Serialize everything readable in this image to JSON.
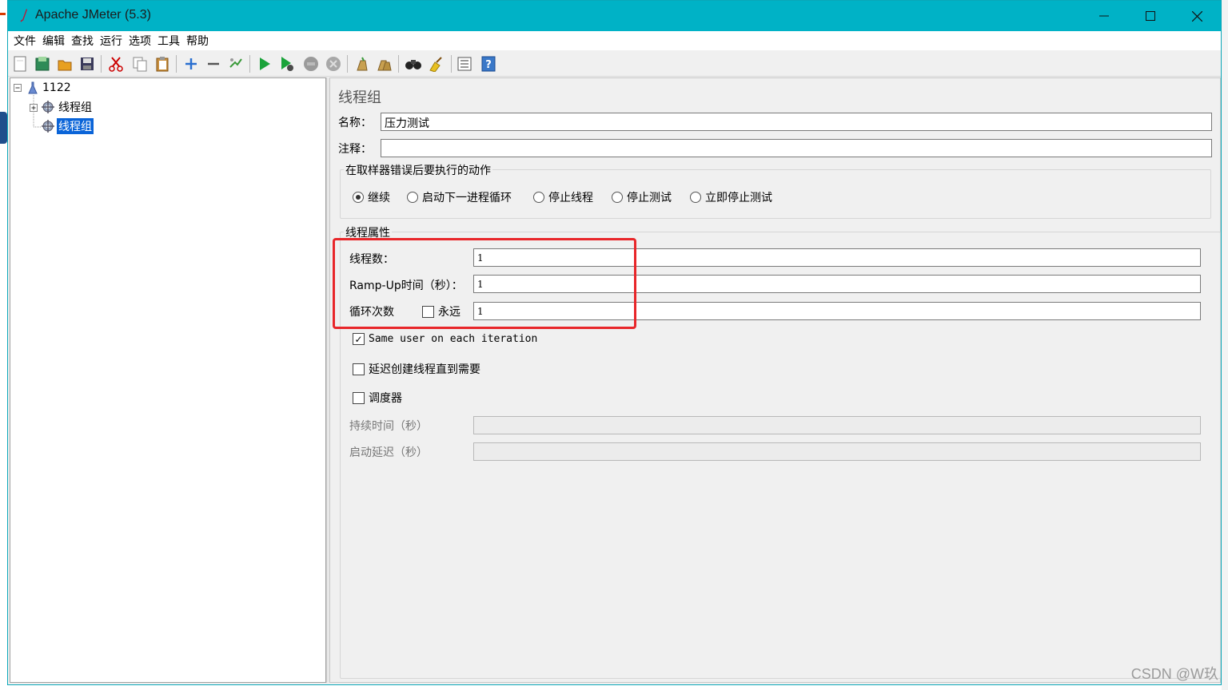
{
  "window": {
    "title": "Apache JMeter (5.3)",
    "controls": {
      "minimize": "—",
      "maximize": "☐",
      "close": "✕"
    }
  },
  "menu": [
    "文件",
    "编辑",
    "查找",
    "运行",
    "选项",
    "工具",
    "帮助"
  ],
  "toolbar": {
    "buttons": [
      "new-icon",
      "templates-icon",
      "open-icon",
      "save-icon",
      "cut-icon",
      "copy-icon",
      "paste-icon",
      "expand-icon",
      "collapse-icon",
      "toggle-icon",
      "start-icon",
      "start-no-timers-icon",
      "stop-icon",
      "shutdown-icon",
      "clear-icon",
      "clear-all-icon",
      "search-icon",
      "reset-search-icon",
      "function-helper-icon",
      "help-icon"
    ]
  },
  "tree": {
    "root": "1122",
    "children": [
      {
        "label": "线程组",
        "selected": false
      },
      {
        "label": "线程组",
        "selected": true
      }
    ]
  },
  "panel": {
    "title": "线程组",
    "name_label": "名称：",
    "name_value": "压力测试",
    "comment_label": "注释：",
    "comment_value": "",
    "error_action": {
      "title": "在取样器错误后要执行的动作",
      "options": [
        "继续",
        "启动下一进程循环",
        "停止线程",
        "停止测试",
        "立即停止测试"
      ],
      "selected": "继续"
    },
    "thread_props": {
      "title": "线程属性",
      "threads_label": "线程数：",
      "threads_value": "1",
      "rampup_label": "Ramp-Up时间（秒）：",
      "rampup_value": "1",
      "loop_label": "循环次数",
      "forever_label": "永远",
      "forever_checked": false,
      "loop_value": "1",
      "same_user_label": "Same user on each iteration",
      "same_user_checked": true,
      "delay_label": "延迟创建线程直到需要",
      "delay_checked": false,
      "scheduler_label": "调度器",
      "scheduler_checked": false,
      "duration_label": "持续时间（秒）",
      "duration_value": "",
      "startup_delay_label": "启动延迟（秒）",
      "startup_delay_value": ""
    }
  },
  "watermark": "CSDN @W玖",
  "colors": {
    "titlebar": "#00b2c6",
    "selection": "#0a64d8",
    "highlight": "#e8262a"
  }
}
